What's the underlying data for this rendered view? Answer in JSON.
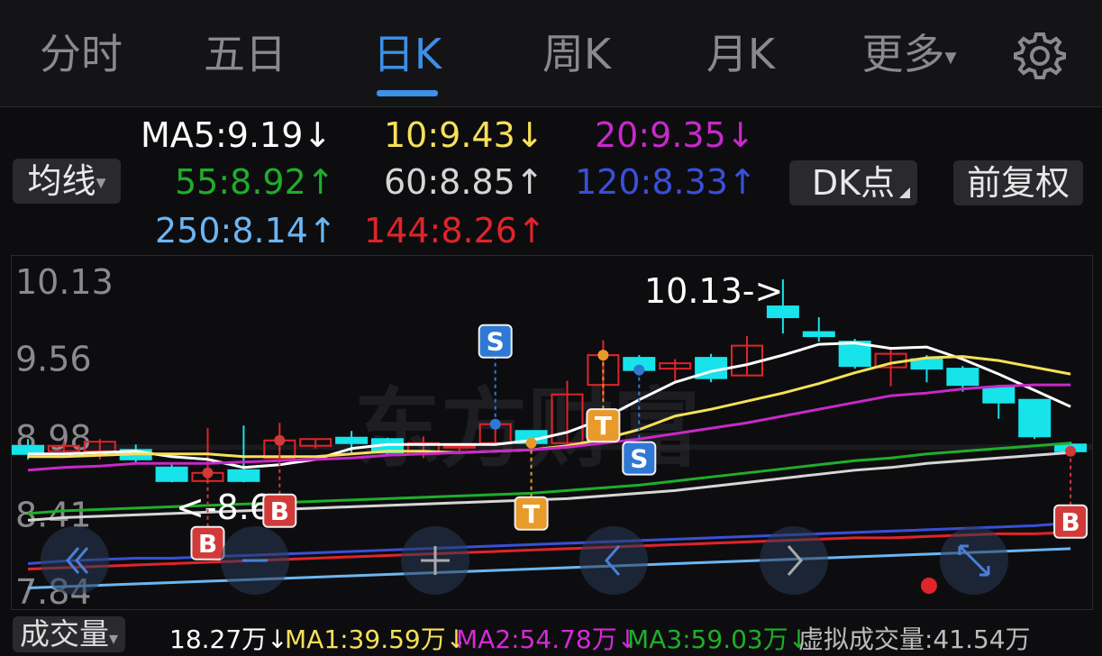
{
  "tabs": [
    {
      "label": "分时",
      "active": false
    },
    {
      "label": "五日",
      "active": false
    },
    {
      "label": "日K",
      "active": true
    },
    {
      "label": "周K",
      "active": false
    },
    {
      "label": "月K",
      "active": false
    },
    {
      "label": "更多",
      "active": false
    }
  ],
  "more_arrow": "▾",
  "settings_icon": "gear-icon",
  "ma_selector": {
    "label": "均线",
    "arrow": "▾"
  },
  "dk_button": {
    "label": "DK点"
  },
  "adjust_button": {
    "label": "前复权"
  },
  "ma_values": [
    {
      "text": "MA5:9.19↓",
      "color": "#ffffff"
    },
    {
      "text": "10:9.43↓",
      "color": "#f6e05a"
    },
    {
      "text": "20:9.35↓",
      "color": "#c829c8"
    },
    {
      "text": "55:8.92↑",
      "color": "#1fae2a"
    },
    {
      "text": "60:8.85↑",
      "color": "#d6d6d6"
    },
    {
      "text": "120:8.33↑",
      "color": "#3a4fd8"
    },
    {
      "text": "250:8.14↑",
      "color": "#6bb6f2"
    },
    {
      "text": "144:8.26↑",
      "color": "#e0242a"
    }
  ],
  "axis_labels": [
    "10.13",
    "9.56",
    "8.98",
    "8.41",
    "7.84"
  ],
  "annotations": {
    "high": "10.13->",
    "low": "<-8.64"
  },
  "markers": {
    "sell": "S",
    "take": "T",
    "buy": "B"
  },
  "watermark": "东方财富",
  "nav_icons": [
    "double-left-icon",
    "b-marker-icon",
    "plus-icon",
    "chevron-left-icon",
    "chevron-right-icon",
    "expand-icon"
  ],
  "volume": {
    "label": "成交量",
    "arrow": "▾",
    "items": [
      {
        "text": "18.27万↓",
        "color": "#ffffff"
      },
      {
        "text": "MA1:39.59万↓",
        "color": "#f6e05a"
      },
      {
        "text": "MA2:54.78万↓",
        "color": "#d62ad6"
      },
      {
        "text": "MA3:59.03万↓",
        "color": "#1fae2a"
      },
      {
        "text": "虚拟成交量:41.54万",
        "color": "#bbbbbb"
      }
    ]
  },
  "colors": {
    "up": "#e0242a",
    "down": "#17e3ea",
    "accent": "#3d8fe8",
    "signal_s": "#2f78d6",
    "signal_t": "#e89a2a",
    "signal_b": "#d23a3a"
  },
  "chart_data": {
    "type": "candlestick",
    "ylim": [
      7.84,
      10.13
    ],
    "y_ticks": [
      10.13,
      9.56,
      8.98,
      8.41,
      7.84
    ],
    "candles": [
      {
        "o": 8.9,
        "c": 8.84,
        "h": 8.95,
        "l": 8.8
      },
      {
        "o": 8.86,
        "c": 8.9,
        "h": 8.93,
        "l": 8.81
      },
      {
        "o": 8.86,
        "c": 8.93,
        "h": 8.95,
        "l": 8.8
      },
      {
        "o": 8.87,
        "c": 8.8,
        "h": 8.91,
        "l": 8.77
      },
      {
        "o": 8.74,
        "c": 8.64,
        "h": 8.77,
        "l": 8.63
      },
      {
        "o": 8.64,
        "c": 8.7,
        "h": 9.03,
        "l": 8.64
      },
      {
        "o": 8.72,
        "c": 8.64,
        "h": 9.05,
        "l": 8.63
      },
      {
        "o": 8.81,
        "c": 8.94,
        "h": 9.07,
        "l": 8.81
      },
      {
        "o": 8.9,
        "c": 8.95,
        "h": 8.95,
        "l": 8.88
      },
      {
        "o": 8.96,
        "c": 8.92,
        "h": 9.01,
        "l": 8.85
      },
      {
        "o": 8.95,
        "c": 8.85,
        "h": 8.96,
        "l": 8.84
      },
      {
        "o": 8.84,
        "c": 8.92,
        "h": 8.97,
        "l": 8.81
      },
      {
        "o": 8.9,
        "c": 8.9,
        "h": 8.92,
        "l": 8.86
      },
      {
        "o": 8.92,
        "c": 9.06,
        "h": 9.08,
        "l": 8.9
      },
      {
        "o": 9.01,
        "c": 8.92,
        "h": 9.01,
        "l": 8.88
      },
      {
        "o": 8.92,
        "c": 9.28,
        "h": 9.38,
        "l": 8.91
      },
      {
        "o": 9.35,
        "c": 9.57,
        "h": 9.68,
        "l": 9.24
      },
      {
        "o": 9.55,
        "c": 9.46,
        "h": 9.57,
        "l": 9.42
      },
      {
        "o": 9.47,
        "c": 9.51,
        "h": 9.54,
        "l": 9.38
      },
      {
        "o": 9.55,
        "c": 9.4,
        "h": 9.58,
        "l": 9.37
      },
      {
        "o": 9.42,
        "c": 9.64,
        "h": 9.71,
        "l": 9.42
      },
      {
        "o": 9.93,
        "c": 9.85,
        "h": 10.13,
        "l": 9.73
      },
      {
        "o": 9.74,
        "c": 9.71,
        "h": 9.85,
        "l": 9.67
      },
      {
        "o": 9.67,
        "c": 9.49,
        "h": 9.69,
        "l": 9.47
      },
      {
        "o": 9.48,
        "c": 9.58,
        "h": 9.62,
        "l": 9.34
      },
      {
        "o": 9.54,
        "c": 9.47,
        "h": 9.57,
        "l": 9.37
      },
      {
        "o": 9.47,
        "c": 9.35,
        "h": 9.49,
        "l": 9.3
      },
      {
        "o": 9.33,
        "c": 9.22,
        "h": 9.35,
        "l": 9.1
      },
      {
        "o": 9.24,
        "c": 8.97,
        "h": 9.24,
        "l": 8.95
      },
      {
        "o": 8.91,
        "c": 8.86,
        "h": 8.93,
        "l": 8.84
      }
    ],
    "ma_lines": [
      {
        "name": "MA5",
        "color": "#ffffff",
        "values": [
          8.84,
          8.84,
          8.85,
          8.86,
          8.82,
          8.8,
          8.74,
          8.76,
          8.8,
          8.88,
          8.91,
          8.91,
          8.91,
          8.91,
          8.94,
          9.0,
          9.1,
          9.24,
          9.37,
          9.45,
          9.5,
          9.57,
          9.65,
          9.66,
          9.62,
          9.63,
          9.54,
          9.43,
          9.31,
          9.19
        ]
      },
      {
        "name": "10",
        "color": "#f6e05a",
        "values": [
          8.82,
          8.82,
          8.83,
          8.84,
          8.84,
          8.84,
          8.82,
          8.82,
          8.82,
          8.84,
          8.86,
          8.86,
          8.85,
          8.86,
          8.87,
          8.9,
          8.95,
          9.02,
          9.12,
          9.17,
          9.23,
          9.29,
          9.36,
          9.44,
          9.51,
          9.55,
          9.56,
          9.53,
          9.48,
          9.43
        ]
      },
      {
        "name": "20",
        "color": "#c829c8",
        "values": [
          8.72,
          8.74,
          8.75,
          8.77,
          8.77,
          8.77,
          8.78,
          8.79,
          8.8,
          8.81,
          8.83,
          8.84,
          8.85,
          8.86,
          8.87,
          8.89,
          8.92,
          8.95,
          8.99,
          9.03,
          9.07,
          9.12,
          9.17,
          9.22,
          9.27,
          9.29,
          9.32,
          9.34,
          9.35,
          9.35
        ]
      },
      {
        "name": "55",
        "color": "#1fae2a",
        "values": [
          8.4,
          8.42,
          8.43,
          8.44,
          8.45,
          8.46,
          8.47,
          8.48,
          8.49,
          8.5,
          8.51,
          8.52,
          8.53,
          8.54,
          8.55,
          8.57,
          8.59,
          8.61,
          8.64,
          8.67,
          8.7,
          8.73,
          8.76,
          8.79,
          8.81,
          8.84,
          8.86,
          8.88,
          8.9,
          8.92
        ]
      },
      {
        "name": "60",
        "color": "#d6d6d6",
        "values": [
          8.35,
          8.37,
          8.38,
          8.39,
          8.4,
          8.41,
          8.42,
          8.43,
          8.44,
          8.45,
          8.46,
          8.47,
          8.48,
          8.49,
          8.5,
          8.51,
          8.53,
          8.55,
          8.57,
          8.6,
          8.63,
          8.66,
          8.69,
          8.72,
          8.74,
          8.77,
          8.79,
          8.81,
          8.83,
          8.85
        ]
      },
      {
        "name": "120",
        "color": "#3a4fd8",
        "values": [
          8.03,
          8.05,
          8.06,
          8.07,
          8.07,
          8.08,
          8.09,
          8.1,
          8.11,
          8.12,
          8.13,
          8.14,
          8.15,
          8.16,
          8.17,
          8.18,
          8.19,
          8.2,
          8.21,
          8.22,
          8.23,
          8.24,
          8.25,
          8.26,
          8.27,
          8.28,
          8.29,
          8.3,
          8.31,
          8.33
        ]
      },
      {
        "name": "144",
        "color": "#e0242a",
        "values": [
          7.99,
          8.0,
          8.01,
          8.02,
          8.03,
          8.04,
          8.05,
          8.06,
          8.07,
          8.08,
          8.09,
          8.1,
          8.11,
          8.12,
          8.13,
          8.14,
          8.15,
          8.16,
          8.17,
          8.18,
          8.19,
          8.2,
          8.21,
          8.22,
          8.22,
          8.23,
          8.24,
          8.25,
          8.25,
          8.26
        ]
      },
      {
        "name": "250",
        "color": "#6bb6f2",
        "values": [
          7.85,
          7.86,
          7.87,
          7.88,
          7.89,
          7.9,
          7.91,
          7.92,
          7.93,
          7.94,
          7.95,
          7.96,
          7.97,
          7.98,
          7.99,
          8.0,
          8.01,
          8.02,
          8.03,
          8.04,
          8.05,
          8.06,
          8.07,
          8.08,
          8.09,
          8.1,
          8.11,
          8.12,
          8.13,
          8.14
        ]
      }
    ],
    "signals": [
      {
        "type": "S",
        "index": 13,
        "price": 9.06
      },
      {
        "type": "S",
        "index": 17,
        "price": 9.46
      },
      {
        "type": "T",
        "index": 14,
        "price": 8.92
      },
      {
        "type": "T",
        "index": 16,
        "price": 9.57
      },
      {
        "type": "B",
        "index": 5,
        "price": 8.7
      },
      {
        "type": "B",
        "index": 7,
        "price": 8.94
      },
      {
        "type": "B",
        "index": 29,
        "price": 8.86
      }
    ]
  }
}
